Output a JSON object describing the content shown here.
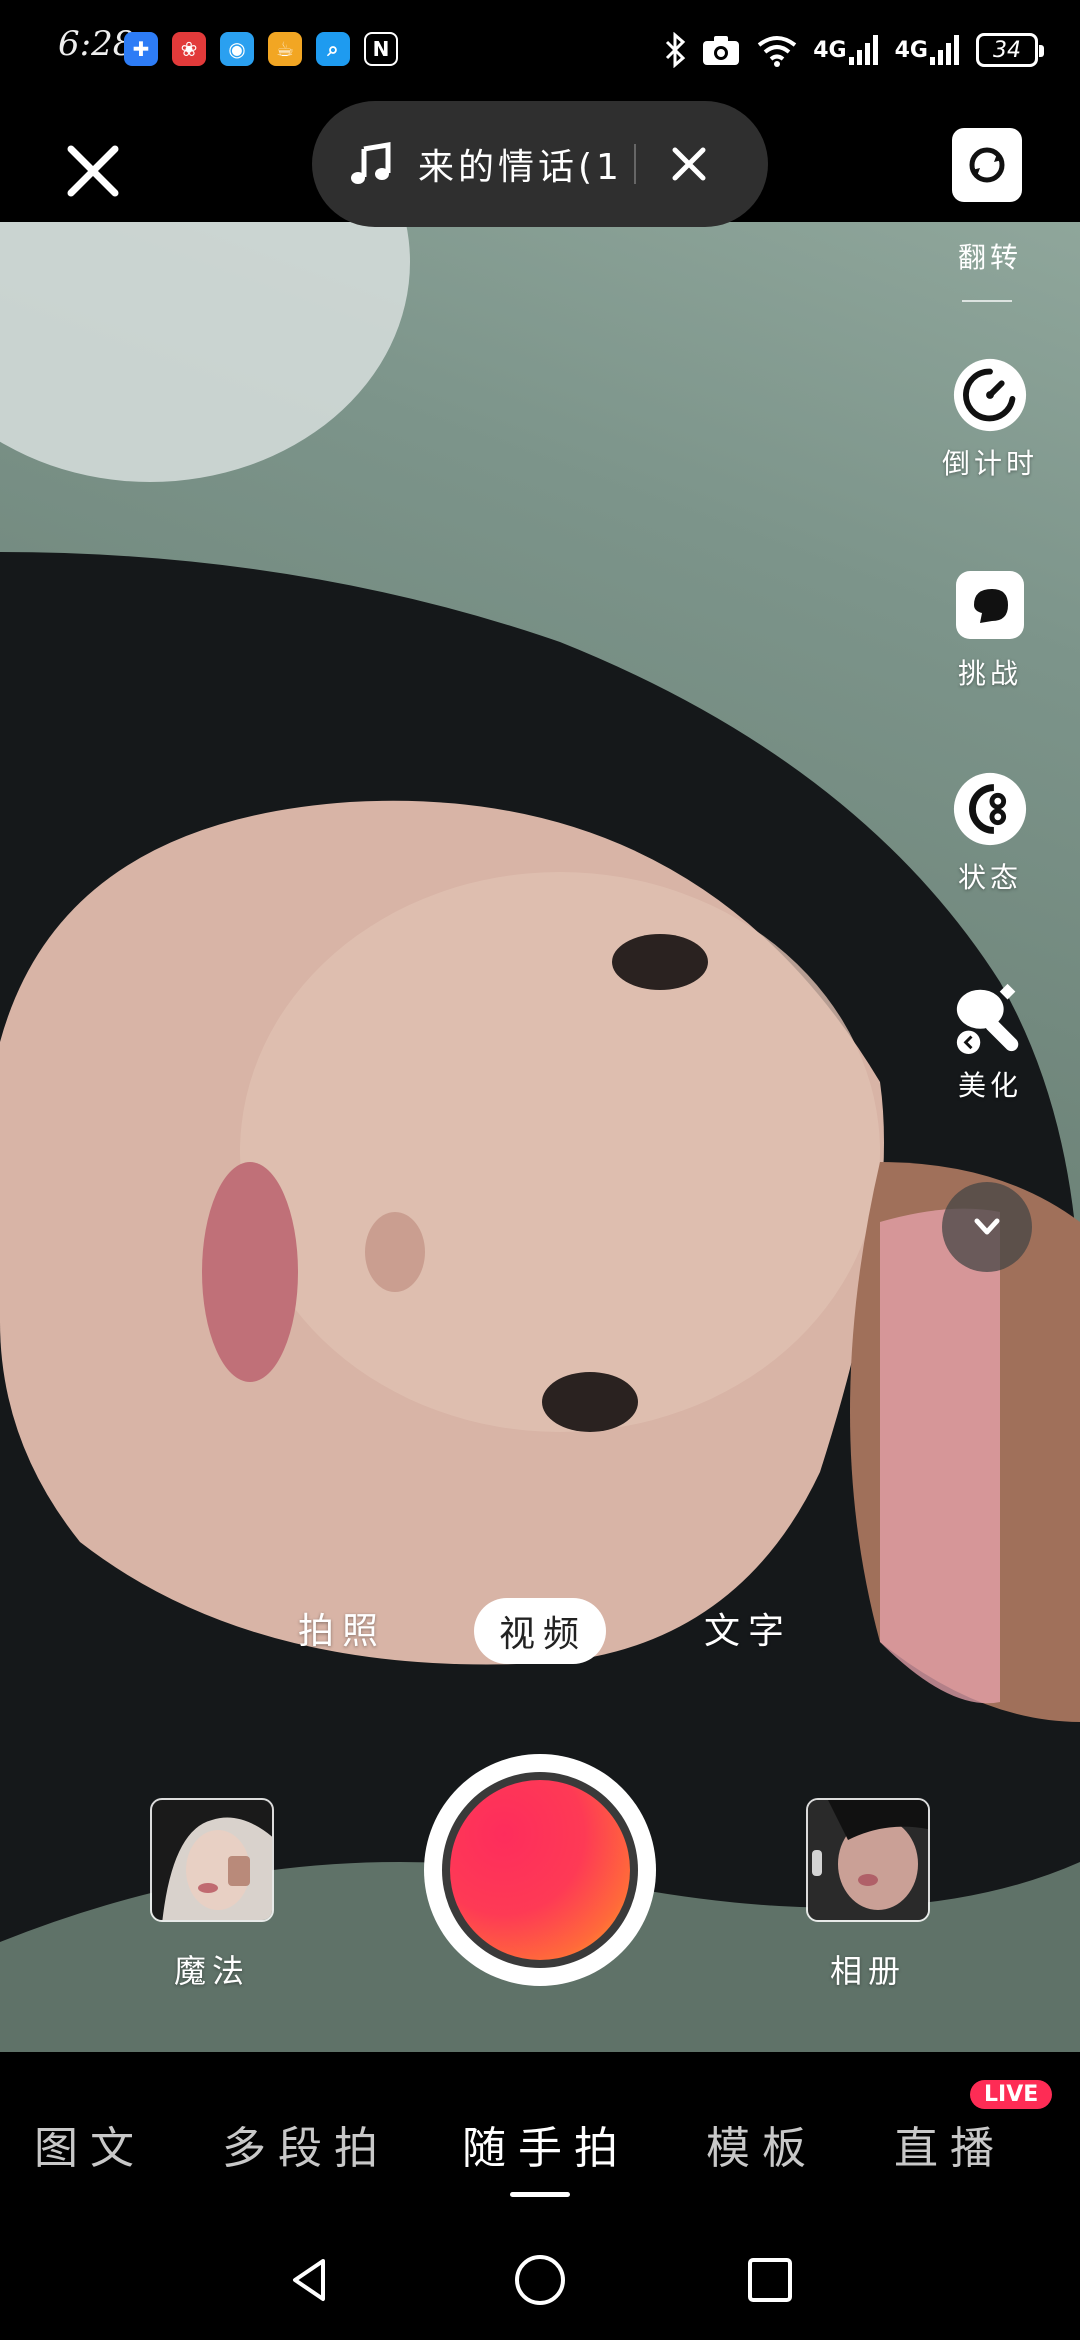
{
  "status_bar": {
    "time": "6:28",
    "notification_icons": [
      "puzzle-icon",
      "huawei-icon",
      "browser-icon",
      "cup-icon",
      "search-app-icon",
      "nfc-icon"
    ],
    "network_1": "4G",
    "network_2": "4G",
    "battery": "34"
  },
  "top": {
    "music_title": "来的情话(1"
  },
  "tools": {
    "flip": "翻转",
    "timer": "倒计时",
    "challenge": "挑战",
    "status": "状态",
    "beauty": "美化"
  },
  "modes": {
    "photo": "拍照",
    "video": "视频",
    "text": "文字"
  },
  "capture": {
    "magic": "魔法",
    "album": "相册"
  },
  "bottom_tabs": [
    {
      "label": "图文",
      "active": false
    },
    {
      "label": "多段拍",
      "active": false
    },
    {
      "label": "随手拍",
      "active": true
    },
    {
      "label": "模板",
      "active": false
    },
    {
      "label": "直播",
      "active": false
    }
  ],
  "live_badge": "LIVE",
  "colors": {
    "accent": "#fe2c55",
    "shutter_start": "#fe2d5c",
    "shutter_end": "#ffae1a"
  }
}
